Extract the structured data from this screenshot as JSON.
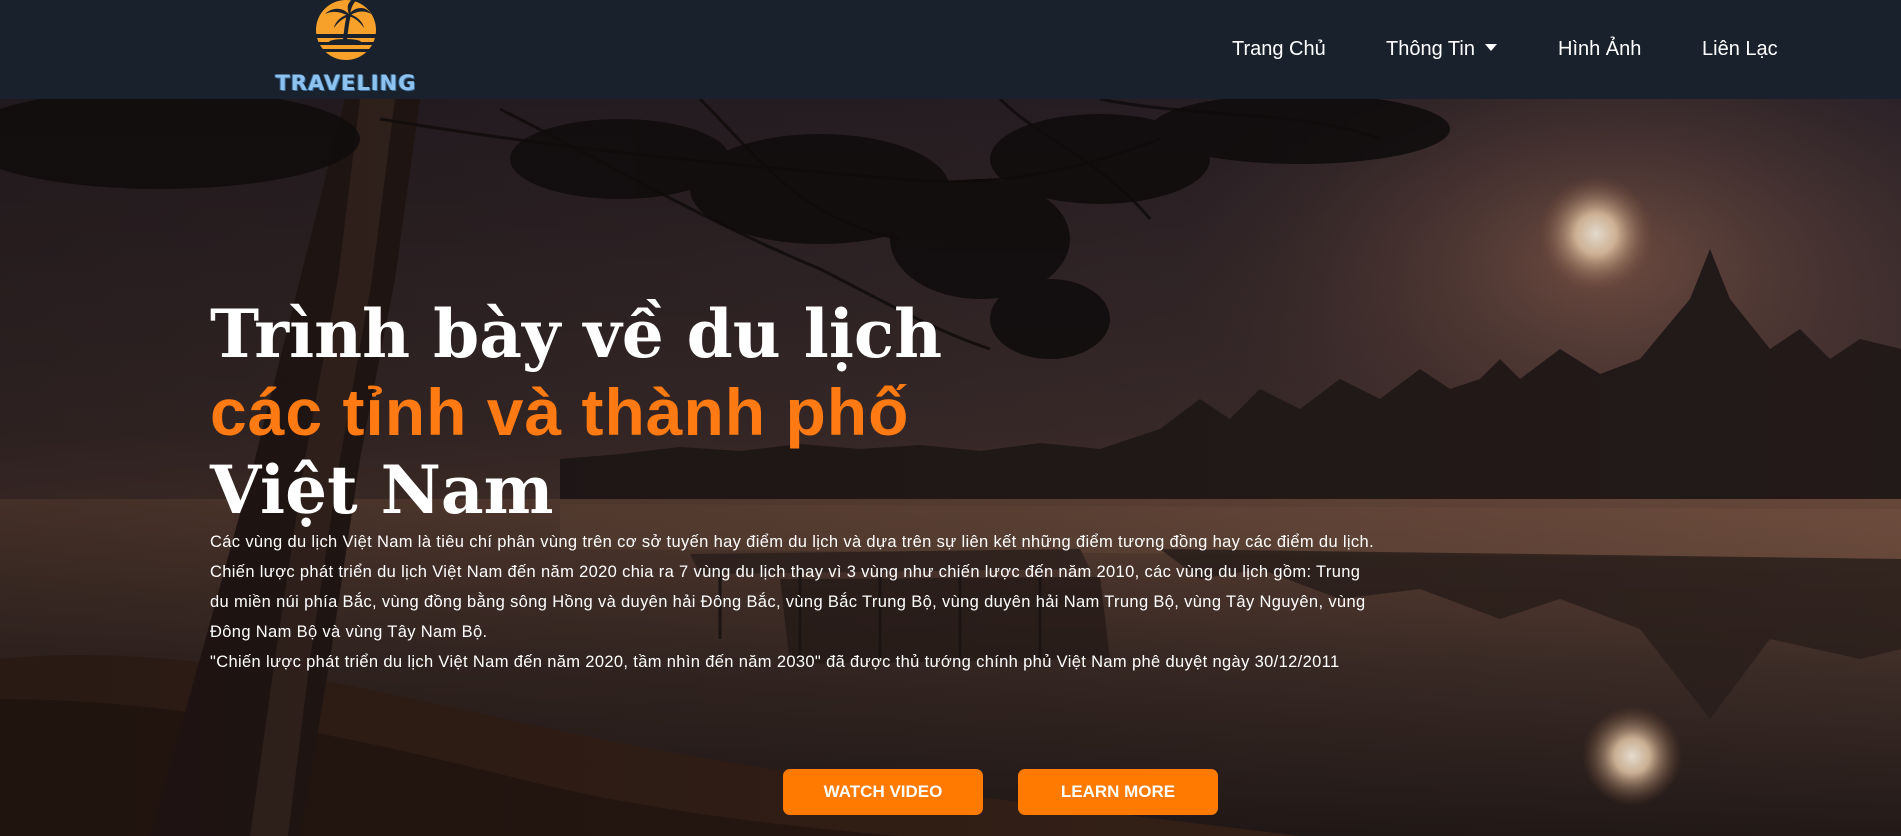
{
  "header": {
    "logo_text": "TRAVELING",
    "nav": {
      "home": "Trang Chủ",
      "info": "Thông Tin",
      "photos": "Hình Ảnh",
      "contact": "Liên Lạc"
    }
  },
  "hero": {
    "title_line1": "Trình bày về du lịch",
    "title_line2": "các tỉnh và thành phố",
    "title_line3": "Việt Nam",
    "paragraph1": "Các vùng du lịch Việt Nam là tiêu chí phân vùng trên cơ sở tuyến hay điểm du lịch và dựa trên sự liên kết những điểm tương đồng hay các điểm du lịch. Chiến lược phát triển du lịch Việt Nam đến năm 2020 chia ra 7 vùng du lịch thay vì 3 vùng như chiến lược đến năm 2010, các vùng du lịch gồm: Trung du miền núi phía Bắc, vùng đồng bằng sông Hồng và duyên hải Đông Bắc, vùng Bắc Trung Bộ, vùng duyên hải Nam Trung Bộ, vùng Tây Nguyên, vùng Đông Nam Bộ và vùng Tây Nam Bộ.",
    "paragraph2": "\"Chiến lược phát triển du lịch Việt Nam đến năm 2020, tầm nhìn đến năm 2030\" đã được thủ tướng chính phủ Việt Nam phê duyệt ngày 30/12/2011",
    "watch_label": "WATCH VIDEO",
    "learn_label": "LEARN MORE"
  },
  "colors": {
    "nav_bg": "#19212d",
    "accent": "#ff7a00",
    "logo_text": "#8ec3ef"
  }
}
